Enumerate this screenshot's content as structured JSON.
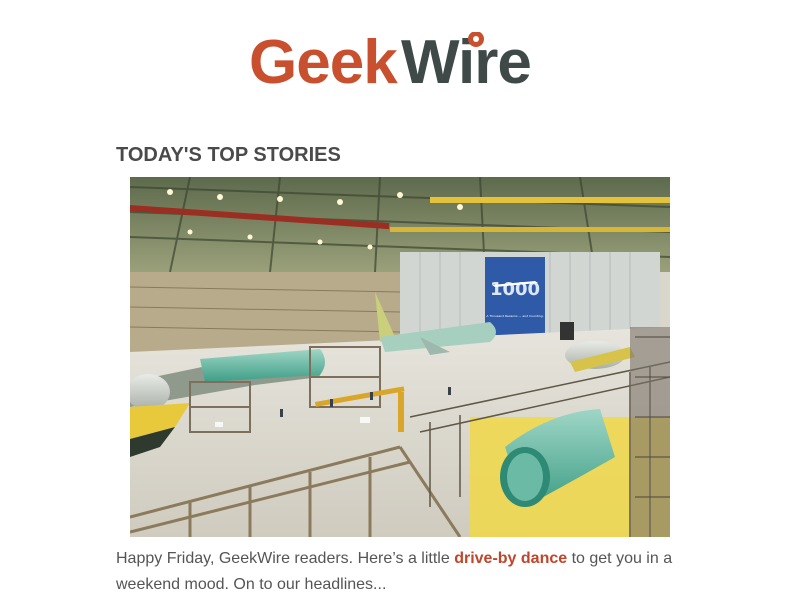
{
  "brand": {
    "name_part1": "Geek",
    "name_part2": "Wire",
    "color_primary": "#c8502e",
    "color_secondary": "#3f4a48"
  },
  "section": {
    "heading": "TODAY'S TOP STORIES"
  },
  "hero_image": {
    "description_icon": "factory-photo",
    "banner_text_large": "1000",
    "banner_text_small": "A Thousand Reasons — and Counting."
  },
  "intro": {
    "text_before_link": "Happy Friday, GeekWire readers. Here’s a little ",
    "link_text": "drive-by dance",
    "text_after_link": " to get you in a weekend mood. On to our headlines...",
    "link_color": "#c0452b"
  }
}
